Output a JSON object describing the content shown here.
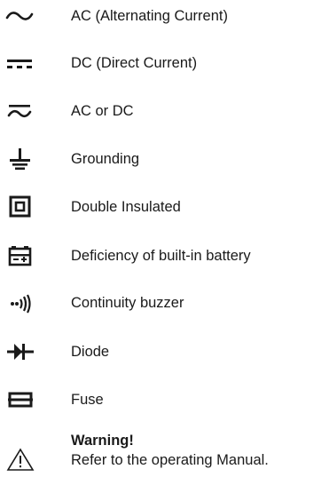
{
  "symbols": [
    {
      "icon": "ac-tilde-icon",
      "label": "AC (Alternating Current)"
    },
    {
      "icon": "dc-icon",
      "label": "DC (Direct Current)"
    },
    {
      "icon": "ac-or-dc-icon",
      "label": "AC or DC"
    },
    {
      "icon": "ground-icon",
      "label": "Grounding"
    },
    {
      "icon": "double-insulated-icon",
      "label": "Double Insulated"
    },
    {
      "icon": "battery-icon",
      "label": "Deficiency of built-in battery"
    },
    {
      "icon": "continuity-buzzer-icon",
      "label": "Continuity buzzer"
    },
    {
      "icon": "diode-icon",
      "label": "Diode"
    },
    {
      "icon": "fuse-icon",
      "label": "Fuse"
    }
  ],
  "warning": {
    "icon": "warning-triangle-icon",
    "title": "Warning!",
    "text": "Refer to the operating Manual."
  }
}
